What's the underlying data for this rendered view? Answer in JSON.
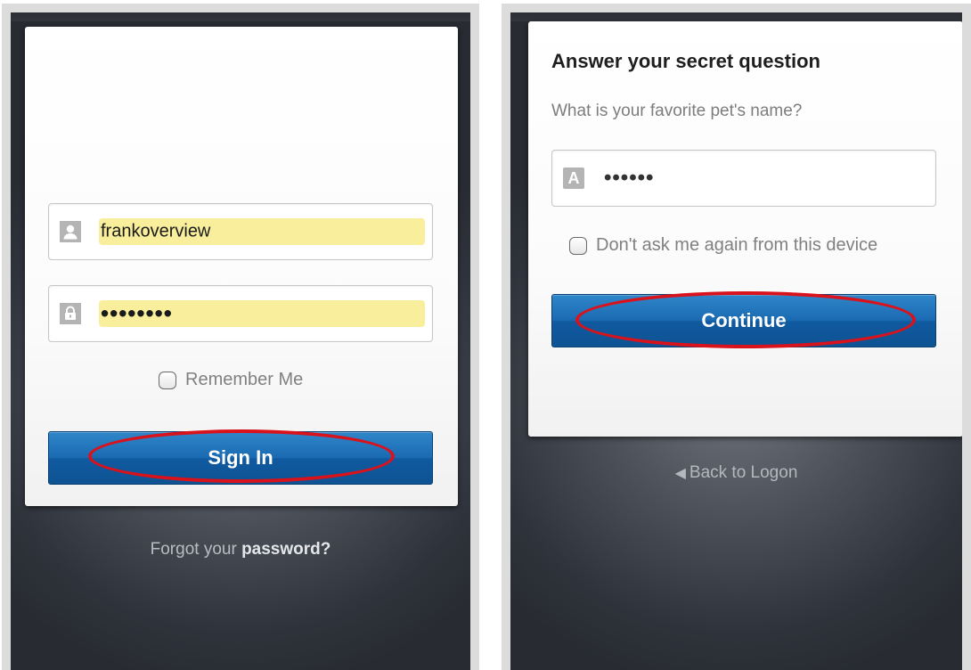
{
  "login_screen": {
    "username_value": "frankoverview",
    "password_value": "••••••••",
    "remember_label": "Remember Me",
    "signin_label": "Sign In",
    "forgot_prefix": "Forgot your ",
    "forgot_link": "password?"
  },
  "secret_screen": {
    "title": "Answer your secret question",
    "question": "What is your favorite pet's name?",
    "answer_icon": "A",
    "answer_value": "••••••",
    "dont_ask_label": "Don't ask me again from this device",
    "continue_label": "Continue",
    "back_label": "Back to Logon"
  },
  "icons": {
    "username": "user-icon",
    "password": "lock-icon",
    "answer": "text-a-icon",
    "back": "arrow-left-icon"
  },
  "colors": {
    "autofill": "#f8ee9c",
    "button_blue": "#1a6ab2",
    "highlight_red": "#d9121b",
    "background_dark": "#2f333b"
  }
}
